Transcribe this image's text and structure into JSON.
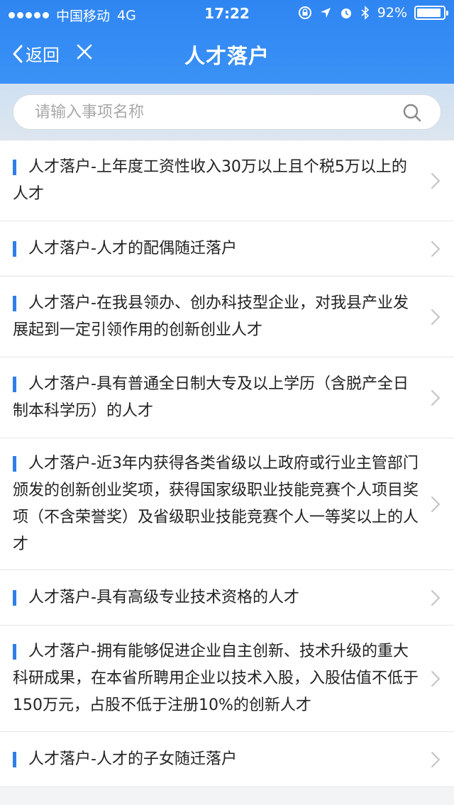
{
  "status": {
    "carrier": "中国移动",
    "network": "4G",
    "time": "17:22",
    "battery": "92%",
    "battery_level": 0.92
  },
  "nav": {
    "back_label": "返回",
    "title": "人才落户"
  },
  "search": {
    "placeholder": "请输入事项名称",
    "value": ""
  },
  "items": [
    {
      "label": "人才落户-上年度工资性收入30万以上且个税5万以上的人才"
    },
    {
      "label": "人才落户-人才的配偶随迁落户"
    },
    {
      "label": "人才落户-在我县领办、创办科技型企业，对我县产业发展起到一定引领作用的创新创业人才"
    },
    {
      "label": "人才落户-具有普通全日制大专及以上学历（含脱产全日制本科学历）的人才"
    },
    {
      "label": "人才落户-近3年内获得各类省级以上政府或行业主管部门颁发的创新创业奖项，获得国家级职业技能竞赛个人项目奖项（不含荣誉奖）及省级职业技能竞赛个人一等奖以上的人才"
    },
    {
      "label": "人才落户-具有高级专业技术资格的人才"
    },
    {
      "label": "人才落户-拥有能够促进企业自主创新、技术升级的重大科研成果，在本省所聘用企业以技术入股，入股估值不低于150万元，占股不低于注册10%的创新人才"
    },
    {
      "label": "人才落户-人才的子女随迁落户"
    }
  ],
  "colors": {
    "header": "#3a8df4",
    "marker": "#2f7fe8"
  }
}
